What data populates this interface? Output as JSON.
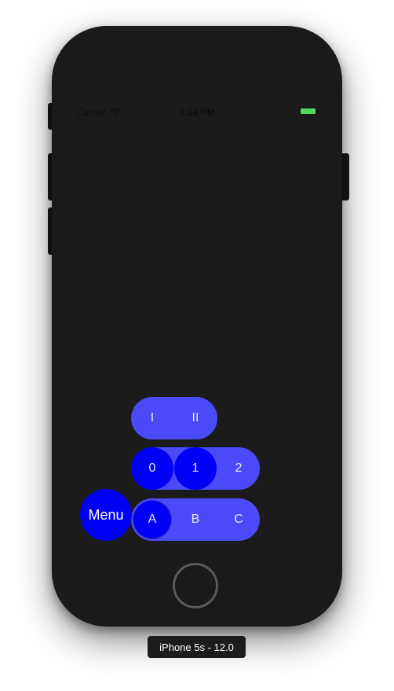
{
  "status_bar": {
    "carrier": "Carrier",
    "time": "5:54 PM",
    "wifi_icon": "wifi-icon",
    "battery_color": "#4cd964"
  },
  "roman_row": {
    "items": [
      {
        "label": "I",
        "selected": false
      },
      {
        "label": "II",
        "selected": false
      }
    ]
  },
  "number_row": {
    "items": [
      {
        "label": "0",
        "selected": true
      },
      {
        "label": "1",
        "selected": true
      },
      {
        "label": "2",
        "selected": false
      }
    ]
  },
  "letter_row": {
    "items": [
      {
        "label": "A",
        "selected": true
      },
      {
        "label": "B",
        "selected": false
      },
      {
        "label": "C",
        "selected": false
      }
    ]
  },
  "menu_button": {
    "label": "Menu"
  },
  "simulator": {
    "device_label": "iPhone 5s - 12.0"
  },
  "colors": {
    "pill": "#4a4af8",
    "selected": "#0000f5",
    "device": "#1a1a1a"
  }
}
